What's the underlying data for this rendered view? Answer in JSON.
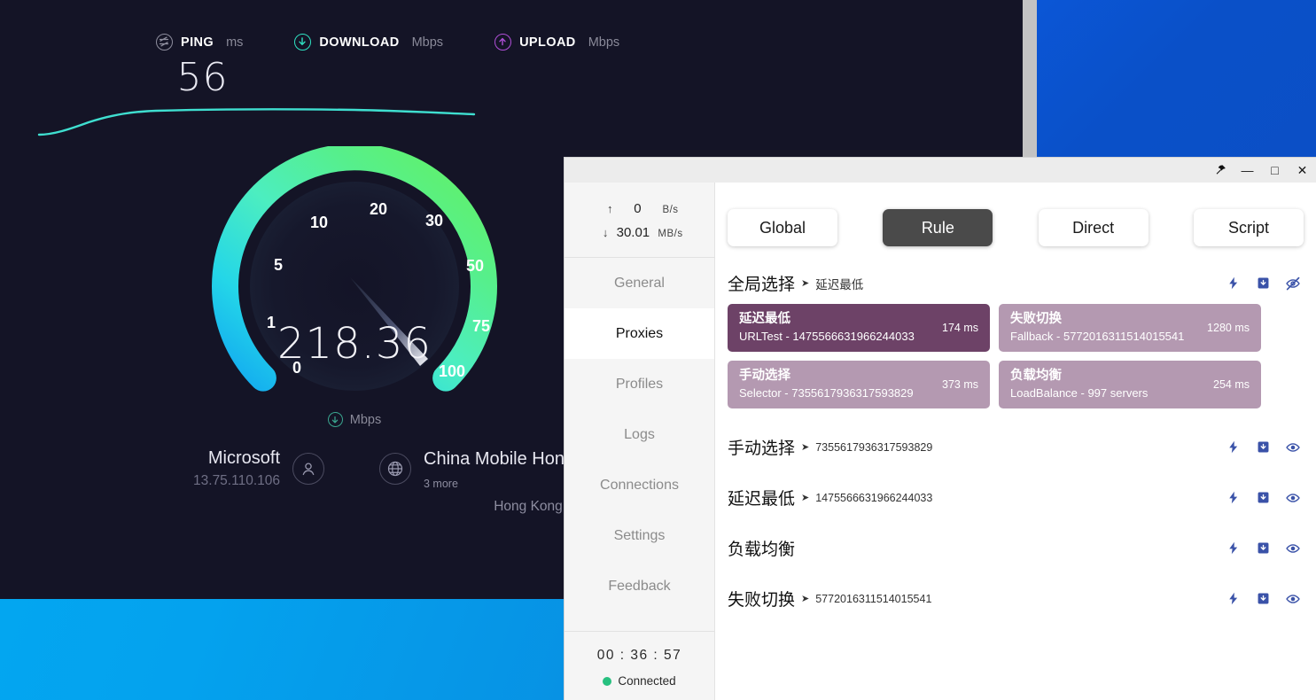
{
  "speedtest": {
    "metrics": [
      {
        "icon": "ping-icon",
        "name": "PING",
        "unit": "ms"
      },
      {
        "icon": "download-icon",
        "name": "DOWNLOAD",
        "unit": "Mbps"
      },
      {
        "icon": "upload-icon",
        "name": "UPLOAD",
        "unit": "Mbps"
      }
    ],
    "ping_value": "56",
    "gauge": {
      "value": "218.36",
      "unit": "Mbps",
      "unit_icon": "download-circle-icon",
      "ticks": [
        "0",
        "1",
        "5",
        "10",
        "20",
        "30",
        "50",
        "75",
        "100"
      ],
      "needle_value": 100
    },
    "isp": {
      "name": "Microsoft",
      "ip": "13.75.110.106",
      "icon": "person-icon"
    },
    "server": {
      "icon": "globe-icon",
      "name": "China Mobile Hong Kong",
      "more": "+ 3 more",
      "location": "Hong Kong"
    }
  },
  "clash": {
    "titlebar": {
      "pin_label": "✦",
      "minimize_label": "—",
      "maximize_label": "□",
      "close_label": "✕"
    },
    "traffic": {
      "up": {
        "arrow": "↑",
        "value": "0",
        "unit": "B/s"
      },
      "down": {
        "arrow": "↓",
        "value": "30.01",
        "unit": "MB/s"
      }
    },
    "nav": [
      {
        "label": "General",
        "active": false
      },
      {
        "label": "Proxies",
        "active": true
      },
      {
        "label": "Profiles",
        "active": false
      },
      {
        "label": "Logs",
        "active": false
      },
      {
        "label": "Connections",
        "active": false
      },
      {
        "label": "Settings",
        "active": false
      },
      {
        "label": "Feedback",
        "active": false
      }
    ],
    "footer": {
      "timer": "00 : 36 : 57",
      "status": "Connected",
      "status_color": "#27c07f"
    },
    "modes": [
      {
        "label": "Global",
        "active": false
      },
      {
        "label": "Rule",
        "active": true
      },
      {
        "label": "Direct",
        "active": false
      },
      {
        "label": "Script",
        "active": false
      }
    ],
    "main_group": {
      "title": "全局选择",
      "arrow": "➤",
      "current": "延迟最低",
      "actions": [
        "speedtest-icon",
        "collapse-icon",
        "eye-off-icon"
      ],
      "cards": [
        {
          "name": "延迟最低",
          "sub": "URLTest - 1475566631966244033",
          "delay": "174 ms",
          "selected": true
        },
        {
          "name": "失败切换",
          "sub": "Fallback - 5772016311514015541",
          "delay": "1280 ms",
          "selected": false
        },
        {
          "name": "手动选择",
          "sub": "Selector - 7355617936317593829",
          "delay": "373 ms",
          "selected": false
        },
        {
          "name": "负载均衡",
          "sub": "LoadBalance - 997 servers",
          "delay": "254 ms",
          "selected": false
        }
      ]
    },
    "groups": [
      {
        "title": "手动选择",
        "arrow": "➤",
        "sub": "7355617936317593829",
        "actions": [
          "speedtest-icon",
          "collapse-icon",
          "eye-icon"
        ]
      },
      {
        "title": "延迟最低",
        "arrow": "➤",
        "sub": "1475566631966244033",
        "actions": [
          "speedtest-icon",
          "collapse-icon",
          "eye-icon"
        ]
      },
      {
        "title": "负载均衡",
        "arrow": "",
        "sub": "",
        "actions": [
          "speedtest-icon",
          "collapse-icon",
          "eye-icon"
        ]
      },
      {
        "title": "失败切换",
        "arrow": "➤",
        "sub": "5772016311514015541",
        "actions": [
          "speedtest-icon",
          "collapse-icon",
          "eye-icon"
        ]
      }
    ]
  },
  "colors": {
    "speedtest_bg": "#141426",
    "gauge_cyan": "#22d3ee",
    "gauge_green": "#5ef07f",
    "accent_purple_selected": "#6d4267",
    "accent_purple": "#b499b1",
    "clash_icon_blue": "#3a52a8"
  }
}
